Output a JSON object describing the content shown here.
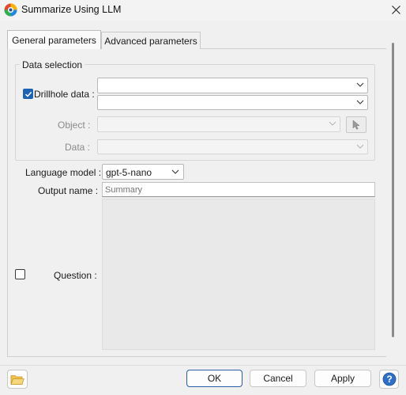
{
  "window": {
    "title": "Summarize Using LLM",
    "icon": "app-logo-icon",
    "close_icon": "close-icon"
  },
  "tabs": [
    {
      "label": "General parameters",
      "active": true
    },
    {
      "label": "Advanced parameters",
      "active": false
    }
  ],
  "data_selection": {
    "title": "Data selection",
    "drillhole": {
      "label": "Drillhole data :",
      "checked": true,
      "combo1_value": "",
      "combo2_value": ""
    },
    "object": {
      "label": "Object :",
      "value": "",
      "enabled": false,
      "pick_icon": "cursor-arrow-icon"
    },
    "data": {
      "label": "Data :",
      "value": "",
      "enabled": false
    }
  },
  "language_model": {
    "label": "Language model :",
    "value": "gpt-5-nano"
  },
  "output_name": {
    "label": "Output name :",
    "value": "",
    "placeholder": "Summary"
  },
  "question": {
    "label": "Question :",
    "checked": false
  },
  "buttons": {
    "ok": "OK",
    "cancel": "Cancel",
    "apply": "Apply",
    "folder_icon": "folder-icon",
    "help_icon": "help-icon"
  },
  "colors": {
    "accent": "#1e63b3",
    "window_bg": "#f0f0f0"
  }
}
